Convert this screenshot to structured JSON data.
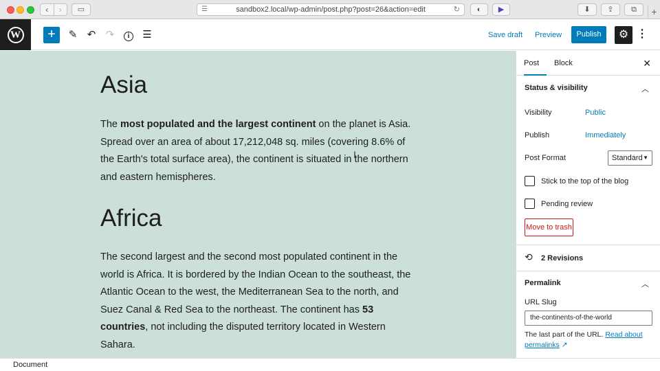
{
  "browser": {
    "url": "sandbox2.local/wp-admin/post.php?post=26&action=edit",
    "back_glyph": "‹",
    "forward_glyph": "›",
    "new_tab_glyph": "+"
  },
  "toolbar": {
    "logo_glyph": "W",
    "inserter_glyph": "+",
    "save_draft_label": "Save draft",
    "preview_label": "Preview",
    "publish_label": "Publish",
    "settings_glyph": "⚙",
    "more_glyph": "⋮"
  },
  "content": {
    "heading1": "Asia",
    "para1": {
      "text_before": "The ",
      "bold1": "most populated and the largest continent",
      "text_after": " on the planet is Asia. Spread over an area of about 17,212,048 sq. miles (covering 8.6% of the Earth's total surface area), the continent is situated in the northern and eastern hemispheres."
    },
    "heading2": "Africa",
    "para2": {
      "text_before": "The second largest and the second most populated continent in the world is Africa. It is bordered by the Indian Ocean to the southeast, the Atlantic Ocean to the west, the Mediterranean Sea to the north, and Suez Canal & Red Sea to the northeast. The continent has ",
      "bold1": "53 countries",
      "text_after": ", not including the disputed territory located in Western Sahara."
    }
  },
  "sidebar": {
    "tab_post": "Post",
    "tab_block": "Block",
    "close_glyph": "✕",
    "status_title": "Status & visibility",
    "visibility_label": "Visibility",
    "visibility_value": "Public",
    "publish_label": "Publish",
    "publish_value": "Immediately",
    "post_format_label": "Post Format",
    "post_format_value": "Standard",
    "sticky_label": "Stick to the top of the blog",
    "pending_label": "Pending review",
    "trash_label": "Move to trash",
    "revisions_label": "2 Revisions",
    "permalink_title": "Permalink",
    "url_slug_label": "URL Slug",
    "url_slug_value": "the-continents-of-the-world",
    "help_text": "The last part of the URL. ",
    "help_link": "Read about permalinks"
  },
  "footer": {
    "breadcrumb": "Document"
  }
}
